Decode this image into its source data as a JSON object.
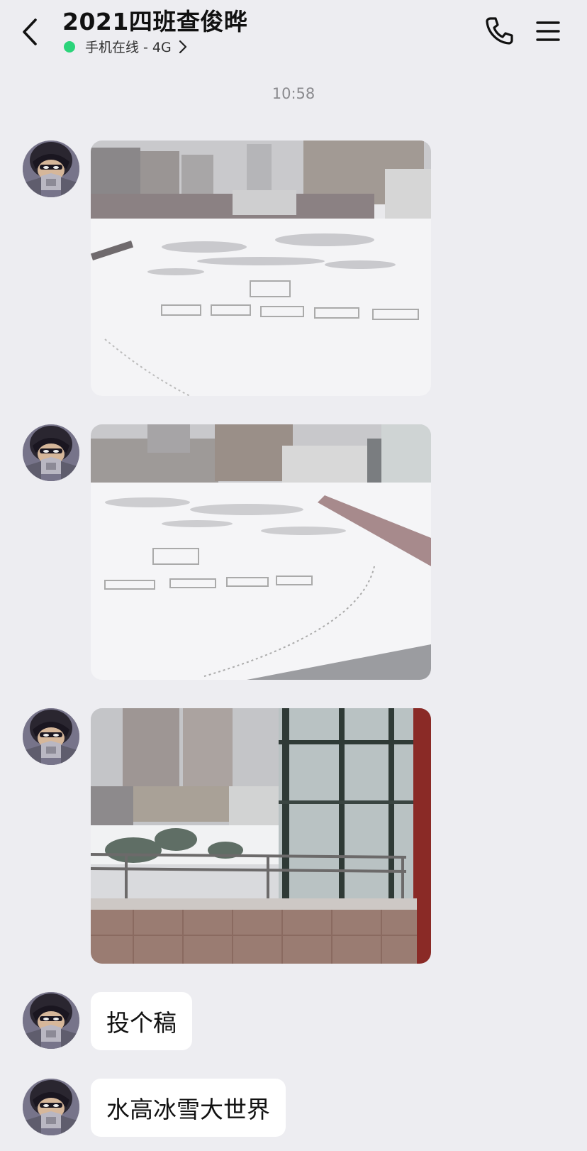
{
  "header": {
    "title": "2021四班查俊晔",
    "status_text": "手机在线 - 4G",
    "status_color": "#2bd47a"
  },
  "icons": {
    "back": "chevron-left-icon",
    "call": "phone-icon",
    "menu": "hamburger-menu-icon",
    "status_more": "chevron-right-icon"
  },
  "chat": {
    "timestamp": "10:58",
    "messages": [
      {
        "type": "image",
        "description_icon": "photo-snowy-field"
      },
      {
        "type": "image",
        "description_icon": "photo-snowy-field-stands"
      },
      {
        "type": "image",
        "description_icon": "photo-balcony-view"
      },
      {
        "type": "text",
        "text": "投个稿"
      },
      {
        "type": "text",
        "text": "水高冰雪大世界"
      }
    ]
  },
  "colors": {
    "background": "#ededf1",
    "bubble": "#ffffff",
    "online": "#2bd47a"
  }
}
